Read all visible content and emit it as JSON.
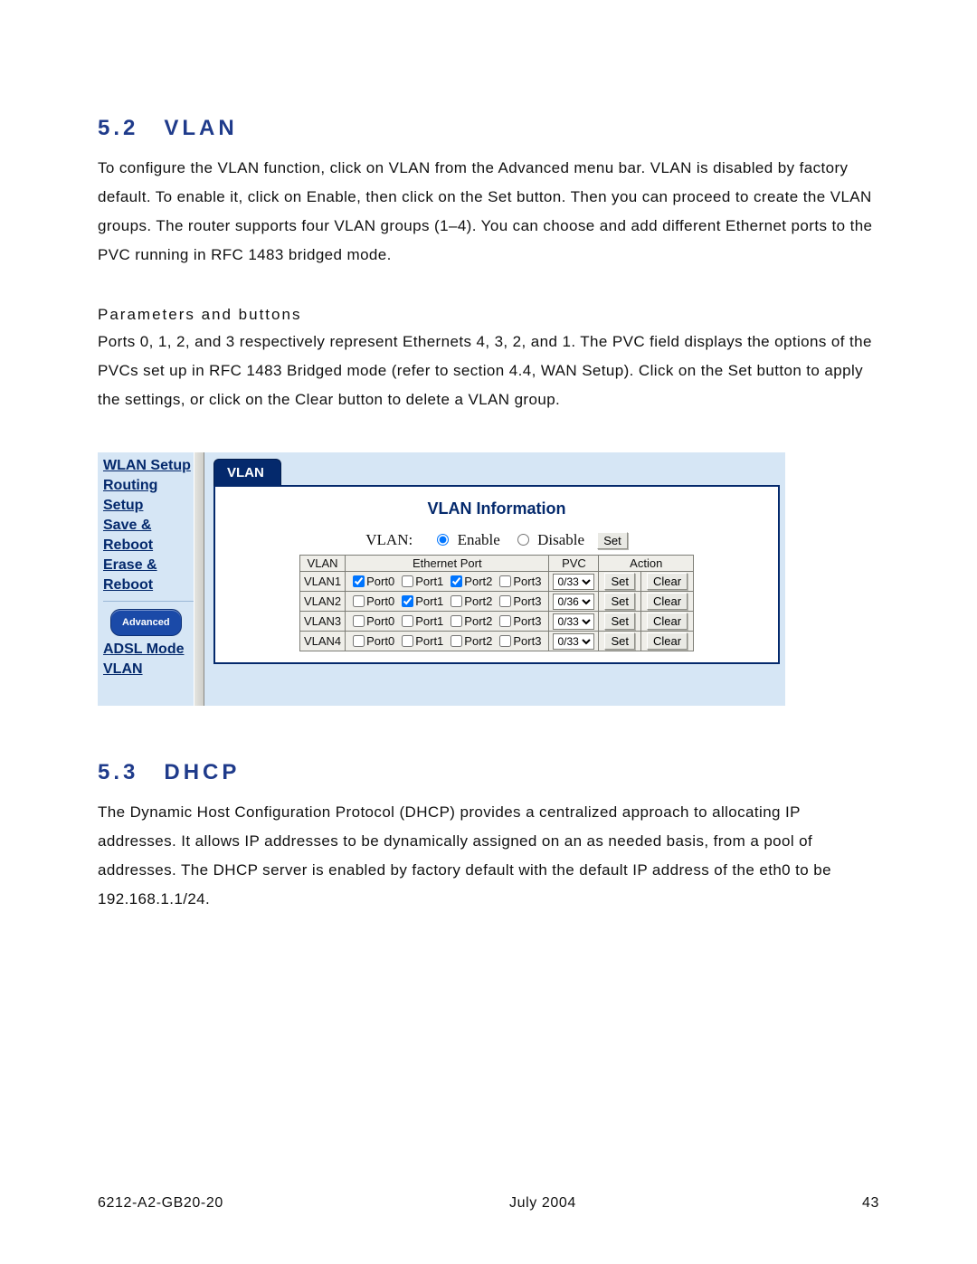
{
  "section52": {
    "number": "5.2",
    "title": "VLAN",
    "para": "To configure the VLAN function, click on VLAN from the Advanced menu bar.  VLAN is disabled by factory default.  To enable it, click on Enable, then click on the Set button. Then you can proceed to create the VLAN groups.  The router supports four VLAN groups (1–4).  You can choose and add different Ethernet ports to the PVC running in RFC 1483 bridged mode.",
    "subhead": "Parameters and buttons",
    "para2": "Ports 0, 1, 2, and 3 respectively represent Ethernets 4, 3, 2, and 1.  The PVC field displays the options of the PVCs set up in RFC 1483 Bridged mode (refer to section 4.4, WAN Setup).  Click on the Set button to apply the settings, or click on the Clear button to delete a VLAN group."
  },
  "section53": {
    "number": "5.3",
    "title": "DHCP",
    "para": "The Dynamic Host Configuration Protocol (DHCP) provides a centralized approach to allocating IP addresses. It allows IP addresses to be dynamically assigned on an as needed basis, from a pool of addresses. The DHCP server is enabled by factory default with the default IP address of the eth0 to be 192.168.1.1/24."
  },
  "footer": {
    "doc": "6212-A2-GB20-20",
    "date": "July 2004",
    "page": "43"
  },
  "ui": {
    "nav": {
      "items": [
        "WLAN Setup",
        "Routing Setup",
        "Save & Reboot",
        "Erase & Reboot"
      ],
      "advanced_btn": "Advanced",
      "adv_items": [
        "ADSL Mode",
        "VLAN"
      ]
    },
    "tab": "VLAN",
    "panel_title": "VLAN Information",
    "radio": {
      "label": "VLAN:",
      "enable": "Enable",
      "disable": "Disable",
      "selected": "enable",
      "set_btn": "Set"
    },
    "headers": {
      "vlan": "VLAN",
      "eth": "Ethernet Port",
      "pvc": "PVC",
      "action": "Action"
    },
    "port_labels": [
      "Port0",
      "Port1",
      "Port2",
      "Port3"
    ],
    "rows": [
      {
        "name": "VLAN1",
        "ports": [
          true,
          false,
          true,
          false
        ],
        "pvc": "0/33"
      },
      {
        "name": "VLAN2",
        "ports": [
          false,
          true,
          false,
          false
        ],
        "pvc": "0/36"
      },
      {
        "name": "VLAN3",
        "ports": [
          false,
          false,
          false,
          false
        ],
        "pvc": "0/33"
      },
      {
        "name": "VLAN4",
        "ports": [
          false,
          false,
          false,
          false
        ],
        "pvc": "0/33"
      }
    ],
    "buttons": {
      "set": "Set",
      "clear": "Clear"
    }
  }
}
